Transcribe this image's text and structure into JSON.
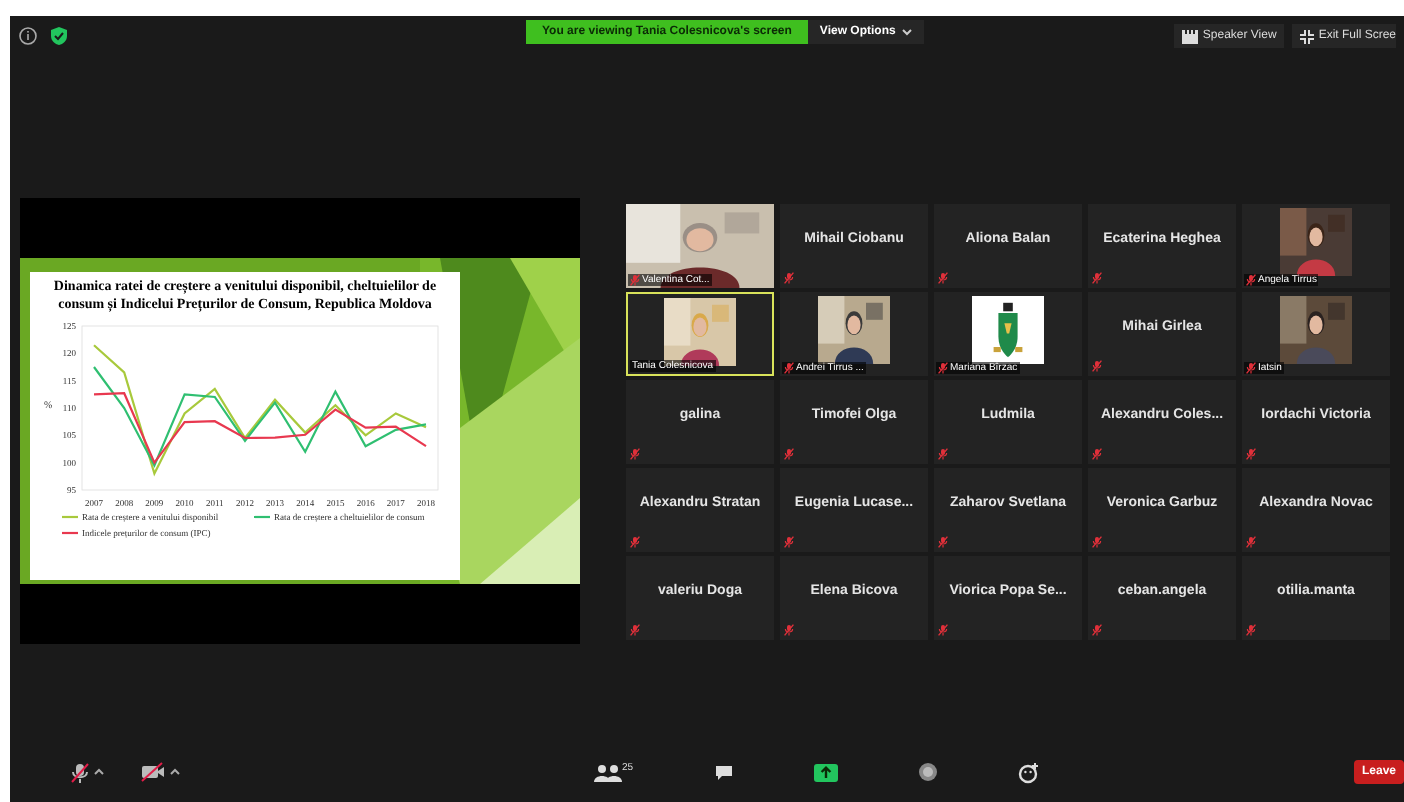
{
  "top_bar": {
    "banner": "You are viewing Tania Colesnicova's screen",
    "view_options": "View Options",
    "speaker_view": "Speaker View",
    "exit_full_screen": "Exit Full Scree"
  },
  "shared_screen": {
    "slide_title": "Dinamica ratei de creștere a venitului disponibil, cheltuielilor de consum și Indicelui Prețurilor de Consum, Republica Moldova",
    "chart_data": {
      "type": "line",
      "legend": true,
      "ylabel": "%",
      "categories": [
        "2007",
        "2008",
        "2009",
        "2010",
        "2011",
        "2012",
        "2013",
        "2014",
        "2015",
        "2016",
        "2017",
        "2018"
      ],
      "ylim": [
        95,
        125
      ],
      "yticks": [
        95,
        100,
        105,
        110,
        115,
        120,
        125
      ],
      "series": [
        {
          "name": "Rata de creștere a venitului disponibil",
          "color": "#a8c93c",
          "values": [
            121.5,
            116.5,
            98,
            109,
            113.5,
            104.5,
            111.5,
            105.5,
            110.5,
            105,
            109,
            106.5
          ]
        },
        {
          "name": "Rata de creștere a cheltuielilor de consum",
          "color": "#2fbf71",
          "values": [
            117.5,
            110,
            99.5,
            112.5,
            112,
            104,
            111,
            102,
            113,
            103,
            106,
            107
          ]
        },
        {
          "name": "Indicele prețurilor de consum (IPC)",
          "color": "#e8384f",
          "values": [
            112.5,
            112.7,
            100,
            107.4,
            107.6,
            104.5,
            104.6,
            105.1,
            109.7,
            106.4,
            106.6,
            103
          ]
        }
      ]
    }
  },
  "participants": [
    {
      "name": "Valentina Cot...",
      "kind": "video",
      "muted": true,
      "active_speaker": false
    },
    {
      "name": "Mihail Ciobanu",
      "kind": "name",
      "muted": true,
      "active_speaker": false
    },
    {
      "name": "Aliona Balan",
      "kind": "name",
      "muted": true,
      "active_speaker": false
    },
    {
      "name": "Ecaterina Heghea",
      "kind": "name",
      "muted": true,
      "active_speaker": false
    },
    {
      "name": "Angela Tirrus",
      "kind": "video",
      "muted": true,
      "active_speaker": false
    },
    {
      "name": "Tania Colesnicova",
      "kind": "video",
      "muted": false,
      "active_speaker": true
    },
    {
      "name": "Andrei Tirrus ...",
      "kind": "video",
      "muted": true,
      "active_speaker": false
    },
    {
      "name": "Mariana Bîrzac",
      "kind": "video",
      "muted": true,
      "active_speaker": false
    },
    {
      "name": "Mihai Girlea",
      "kind": "name",
      "muted": true,
      "active_speaker": false
    },
    {
      "name": "Iatsin",
      "kind": "video",
      "muted": true,
      "active_speaker": false
    },
    {
      "name": "galina",
      "kind": "name",
      "muted": true,
      "active_speaker": false
    },
    {
      "name": "Timofei Olga",
      "kind": "name",
      "muted": true,
      "active_speaker": false
    },
    {
      "name": "Ludmila",
      "kind": "name",
      "muted": true,
      "active_speaker": false
    },
    {
      "name": "Alexandru  Coles...",
      "kind": "name",
      "muted": true,
      "active_speaker": false
    },
    {
      "name": "Iordachi Victoria",
      "kind": "name",
      "muted": true,
      "active_speaker": false
    },
    {
      "name": "Alexandru Stratan",
      "kind": "name",
      "muted": true,
      "active_speaker": false
    },
    {
      "name": "Eugenia  Lucase...",
      "kind": "name",
      "muted": true,
      "active_speaker": false
    },
    {
      "name": "Zaharov Svetlana",
      "kind": "name",
      "muted": true,
      "active_speaker": false
    },
    {
      "name": "Veronica Garbuz",
      "kind": "name",
      "muted": true,
      "active_speaker": false
    },
    {
      "name": "Alexandra Novac",
      "kind": "name",
      "muted": true,
      "active_speaker": false
    },
    {
      "name": "valeriu Doga",
      "kind": "name",
      "muted": true,
      "active_speaker": false
    },
    {
      "name": "Elena Bicova",
      "kind": "name",
      "muted": true,
      "active_speaker": false
    },
    {
      "name": "Viorica  Popa  Se...",
      "kind": "name",
      "muted": true,
      "active_speaker": false
    },
    {
      "name": "ceban.angela",
      "kind": "name",
      "muted": true,
      "active_speaker": false
    },
    {
      "name": "otilia.manta",
      "kind": "name",
      "muted": true,
      "active_speaker": false
    }
  ],
  "toolbar": {
    "participants_count": "25",
    "leave": "Leave"
  }
}
